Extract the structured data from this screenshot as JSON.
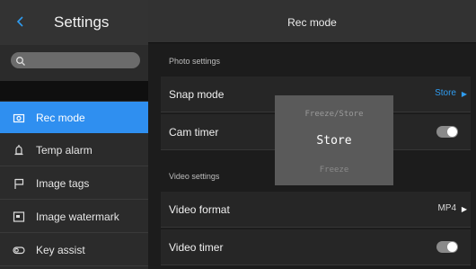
{
  "sidebar": {
    "title": "Settings",
    "items": [
      {
        "label": "Rec mode",
        "icon": "camera-icon",
        "active": true
      },
      {
        "label": "Temp alarm",
        "icon": "alarm-icon",
        "active": false
      },
      {
        "label": "Image tags",
        "icon": "flag-icon",
        "active": false
      },
      {
        "label": "Image watermark",
        "icon": "watermark-icon",
        "active": false
      },
      {
        "label": "Key assist",
        "icon": "toggle-icon",
        "active": false
      }
    ]
  },
  "main": {
    "title": "Rec mode",
    "photo_section": "Photo settings",
    "video_section": "Video settings",
    "rows": {
      "snap_mode": {
        "label": "Snap mode",
        "value": "Store"
      },
      "cam_timer": {
        "label": "Cam timer"
      },
      "video_format": {
        "label": "Video format",
        "value": "MP4"
      },
      "video_timer": {
        "label": "Video timer"
      }
    }
  },
  "picker": {
    "options": [
      "Freeze/Store",
      "Store",
      "Freeze"
    ],
    "selected": "Store"
  },
  "colors": {
    "accent": "#2f8ff0",
    "accent_text": "#2f9cf0"
  }
}
